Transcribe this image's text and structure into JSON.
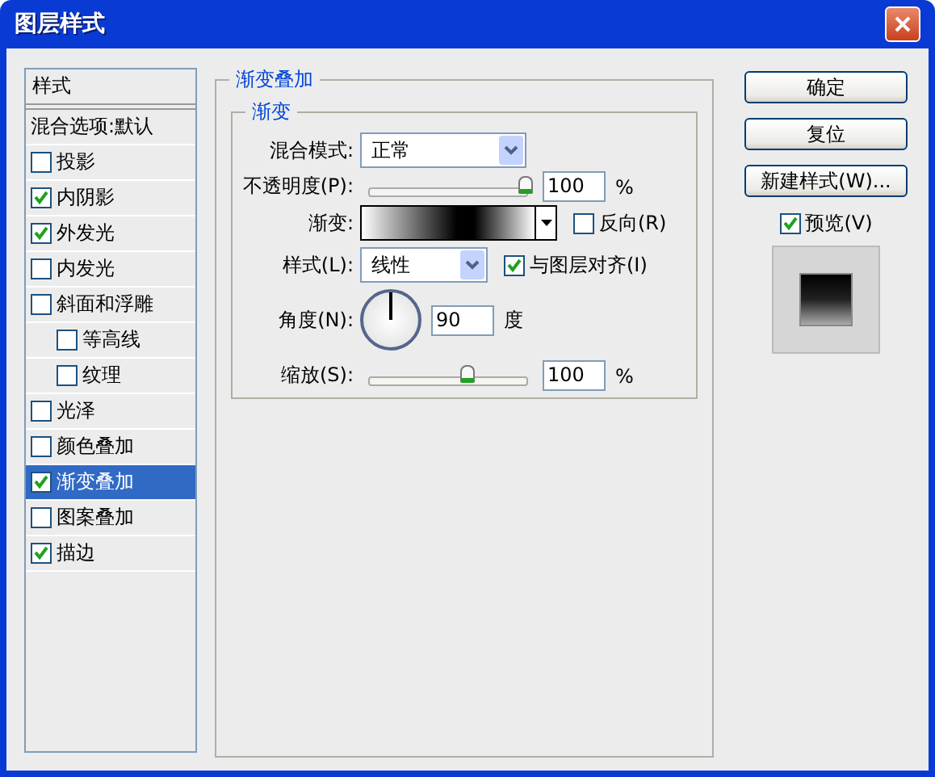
{
  "window": {
    "title": "图层样式"
  },
  "styles_list": {
    "header": "样式",
    "items": [
      {
        "kind": "plain",
        "label": "混合选项:默认",
        "selected": false
      },
      {
        "kind": "check",
        "label": "投影",
        "checked": false,
        "selected": false
      },
      {
        "kind": "check",
        "label": "内阴影",
        "checked": true,
        "selected": false
      },
      {
        "kind": "check",
        "label": "外发光",
        "checked": true,
        "selected": false
      },
      {
        "kind": "check",
        "label": "内发光",
        "checked": false,
        "selected": false
      },
      {
        "kind": "check",
        "label": "斜面和浮雕",
        "checked": false,
        "selected": false,
        "children": [
          {
            "kind": "check",
            "label": "等高线",
            "checked": false,
            "selected": false
          },
          {
            "kind": "check",
            "label": "纹理",
            "checked": false,
            "selected": false
          }
        ]
      },
      {
        "kind": "check",
        "label": "光泽",
        "checked": false,
        "selected": false
      },
      {
        "kind": "check",
        "label": "颜色叠加",
        "checked": false,
        "selected": false
      },
      {
        "kind": "check",
        "label": "渐变叠加",
        "checked": true,
        "selected": true
      },
      {
        "kind": "check",
        "label": "图案叠加",
        "checked": false,
        "selected": false
      },
      {
        "kind": "check",
        "label": "描边",
        "checked": true,
        "selected": false
      }
    ]
  },
  "panel": {
    "title": "渐变叠加",
    "group_title": "渐变",
    "blend_mode": {
      "label": "混合模式:",
      "value": "正常"
    },
    "opacity": {
      "label": "不透明度(P):",
      "level": 1.0,
      "value": "100",
      "unit": "%"
    },
    "gradient": {
      "label": "渐变:",
      "reverse": {
        "label": "反向(R)",
        "checked": false
      }
    },
    "style": {
      "label": "样式(L):",
      "value": "线性",
      "align": {
        "label": "与图层对齐(I)",
        "checked": true
      }
    },
    "angle": {
      "label": "角度(N):",
      "value": "90",
      "unit": "度"
    },
    "scale": {
      "label": "缩放(S):",
      "level": 0.63,
      "value": "100",
      "unit": "%"
    }
  },
  "buttons": [
    "确定",
    "复位",
    "新建样式(W)..."
  ],
  "preview": {
    "label": "预览(V)",
    "checked": true
  }
}
